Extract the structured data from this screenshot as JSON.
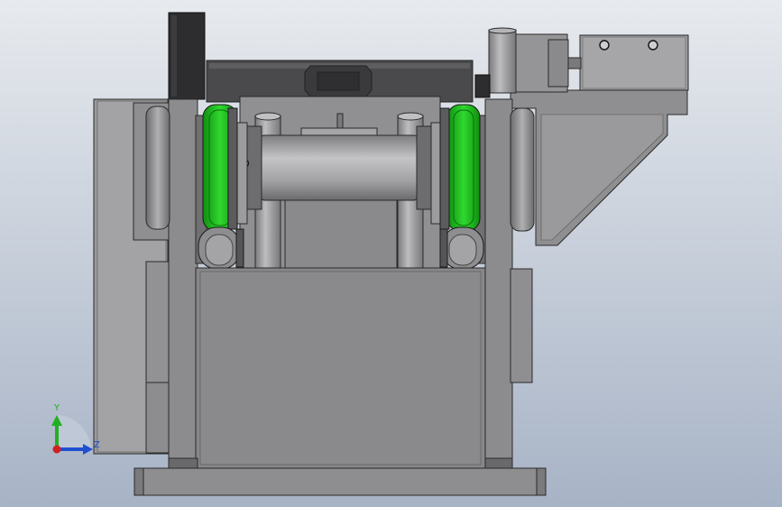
{
  "viewport": {
    "bg_top": "#e7eaee",
    "bg_bottom": "#a7b3c6"
  },
  "colors": {
    "frame": "#8c8c8e",
    "frame_light": "#a9a9ab",
    "frame_dark": "#6e6e70",
    "edge": "#2a2a2a",
    "black_part": "#2d2d2f",
    "roller": "#a4a4a6",
    "pulley_green": "#1fc41f",
    "axis_y": "#22b022",
    "axis_z": "#2050d0",
    "axis_origin": "#d02020"
  },
  "triad": {
    "y_label": "Y",
    "z_label": "Z"
  }
}
